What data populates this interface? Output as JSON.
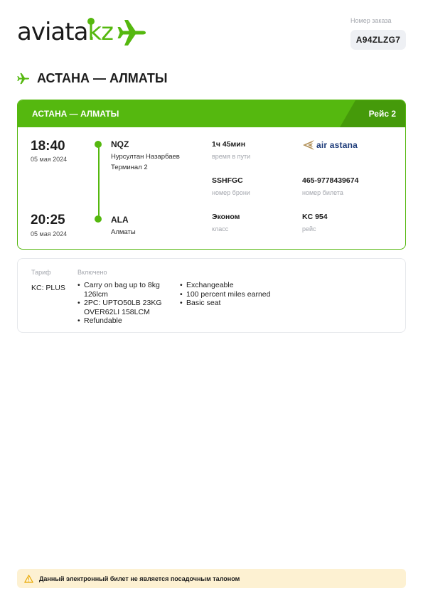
{
  "brand": {
    "name_main": "aviata",
    "name_dot": ".",
    "name_tld": "kz",
    "accent_color": "#55b80f"
  },
  "order": {
    "label": "Номер заказа",
    "number": "A94ZLZG7"
  },
  "heading": {
    "route": "АСТАНА — АЛМАТЫ"
  },
  "flight": {
    "route": "АСТАНА — АЛМАТЫ",
    "flight_label": "Рейс 2",
    "departure": {
      "time": "18:40",
      "date": "05 мая 2024",
      "code": "NQZ",
      "airport": "Нурсултан Назарбаев",
      "terminal": "Терминал 2"
    },
    "arrival": {
      "time": "20:25",
      "date": "05 мая 2024",
      "code": "ALA",
      "airport": "Алматы"
    },
    "duration": {
      "value": "1ч 45мин",
      "label": "время в пути"
    },
    "airline": {
      "name": "air astana",
      "logo_icon": "air-astana-logo-icon"
    },
    "booking": {
      "value": "SSHFGC",
      "label": "номер брони"
    },
    "ticket": {
      "value": "465-9778439674",
      "label": "номер билета"
    },
    "cabin": {
      "value": "Эконом",
      "label": "класс"
    },
    "flight_number": {
      "value": "KC 954",
      "label": "рейс"
    }
  },
  "tariff": {
    "tariff_header": "Тариф",
    "included_header": "Включено",
    "fare_name": "KC: PLUS",
    "included_col1": [
      "Carry on bag up to 8kg 126lcm",
      "2PC: UPTO50LB 23KG OVER62LI 158LCM",
      "Refundable"
    ],
    "included_col2": [
      "Exchangeable",
      "100 percent miles earned",
      "Basic seat"
    ]
  },
  "notice": {
    "text": "Данный электронный билет не является посадочным талоном",
    "icon": "warning-triangle-icon"
  }
}
